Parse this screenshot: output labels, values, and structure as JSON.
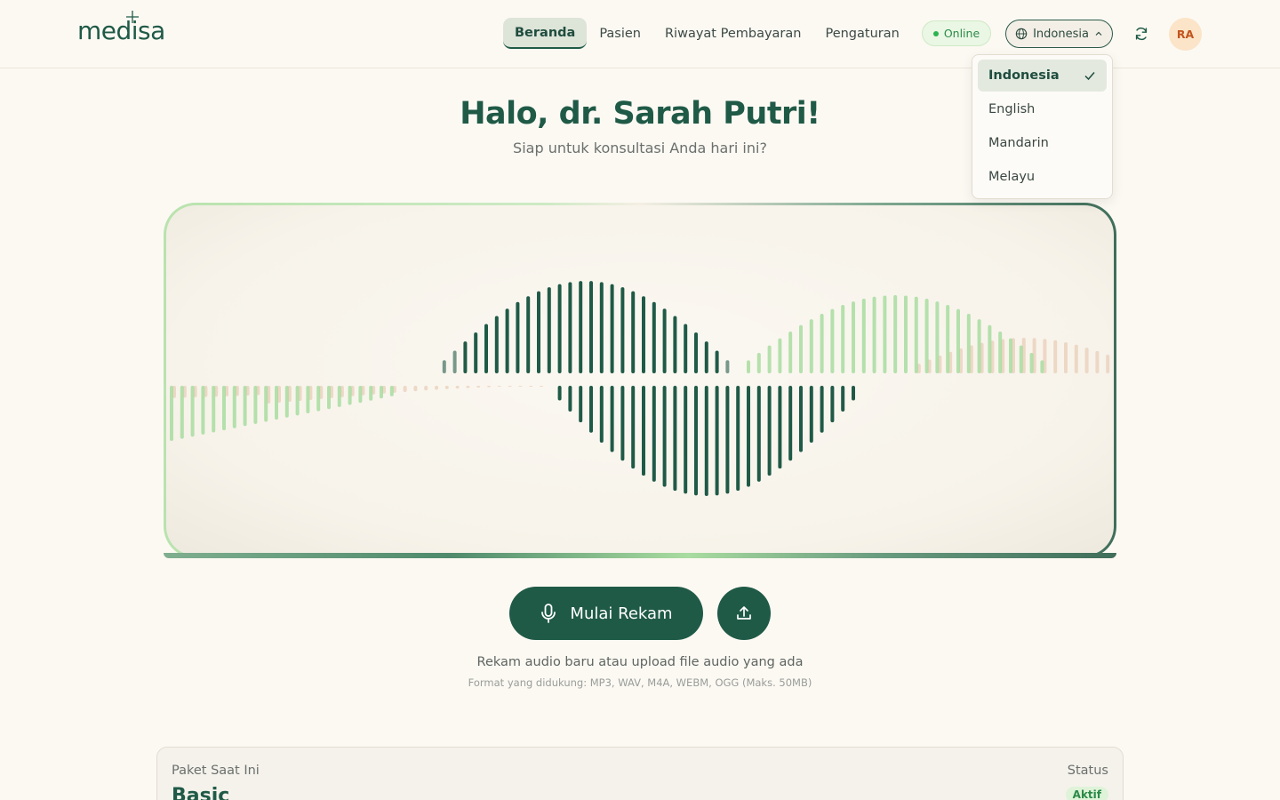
{
  "brand": {
    "name": "medisa"
  },
  "nav": {
    "items": [
      {
        "label": "Beranda",
        "active": true
      },
      {
        "label": "Pasien",
        "active": false
      },
      {
        "label": "Riwayat Pembayaran",
        "active": false
      },
      {
        "label": "Pengaturan",
        "active": false
      }
    ]
  },
  "status": {
    "label": "Online",
    "color": "#2bb34f"
  },
  "language": {
    "current": "Indonesia",
    "options": [
      "Indonesia",
      "English",
      "Mandarin",
      "Melayu"
    ]
  },
  "user": {
    "initials": "RA"
  },
  "greeting": {
    "title": "Halo, dr. Sarah Putri!",
    "subtitle": "Siap untuk konsultasi Anda hari ini?"
  },
  "recorder": {
    "record_label": "Mulai Rekam",
    "hint": "Rekam audio baru atau upload file audio yang ada",
    "formats": "Format yang didukung: MP3, WAV, M4A, WEBM, OGG (Maks. 50MB)"
  },
  "plan": {
    "label": "Paket Saat Ini",
    "name": "Basic",
    "status_label": "Status",
    "status_value": "Aktif"
  },
  "colors": {
    "primary": "#1f5a47",
    "background": "#fcf9f3",
    "wave_dark": "#1f5a47",
    "wave_light": "#a8dca0",
    "wave_peach": "#e9cdb8"
  }
}
